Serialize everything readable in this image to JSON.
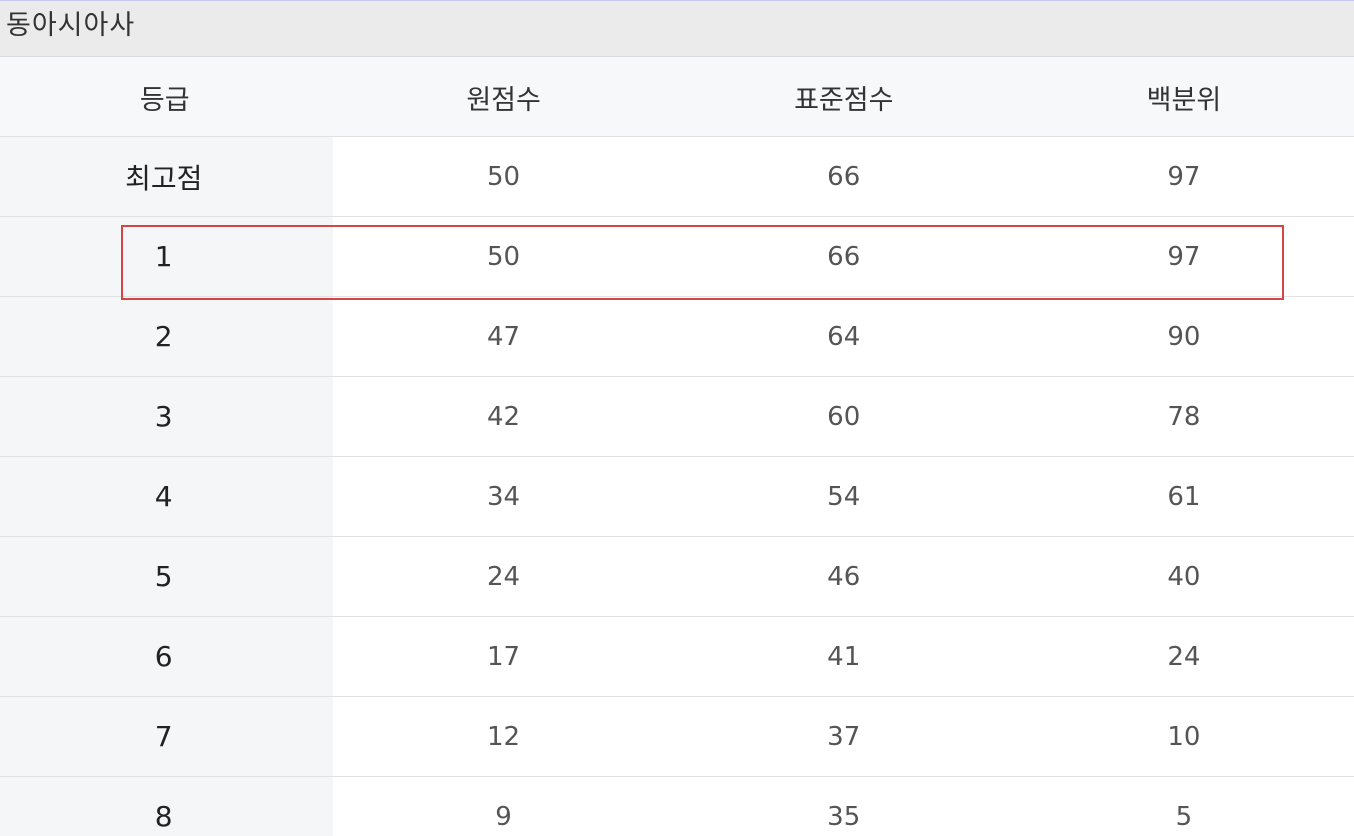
{
  "subject": {
    "title": "동아시아사"
  },
  "table": {
    "headers": [
      "등급",
      "원점수",
      "표준점수",
      "백분위"
    ],
    "rows": [
      {
        "grade": "최고점",
        "raw": "50",
        "standard": "66",
        "percentile": "97"
      },
      {
        "grade": "1",
        "raw": "50",
        "standard": "66",
        "percentile": "97"
      },
      {
        "grade": "2",
        "raw": "47",
        "standard": "64",
        "percentile": "90"
      },
      {
        "grade": "3",
        "raw": "42",
        "standard": "60",
        "percentile": "78"
      },
      {
        "grade": "4",
        "raw": "34",
        "standard": "54",
        "percentile": "61"
      },
      {
        "grade": "5",
        "raw": "24",
        "standard": "46",
        "percentile": "40"
      },
      {
        "grade": "6",
        "raw": "17",
        "standard": "41",
        "percentile": "24"
      },
      {
        "grade": "7",
        "raw": "12",
        "standard": "37",
        "percentile": "10"
      },
      {
        "grade": "8",
        "raw": "9",
        "standard": "35",
        "percentile": "5"
      }
    ],
    "highlighted_row": "1"
  },
  "colors": {
    "highlight_border": "#d64545",
    "header_bg": "#f7f8fa",
    "grade_column_bg": "#f5f6f8",
    "subject_bar_bg": "#ebebeb"
  }
}
